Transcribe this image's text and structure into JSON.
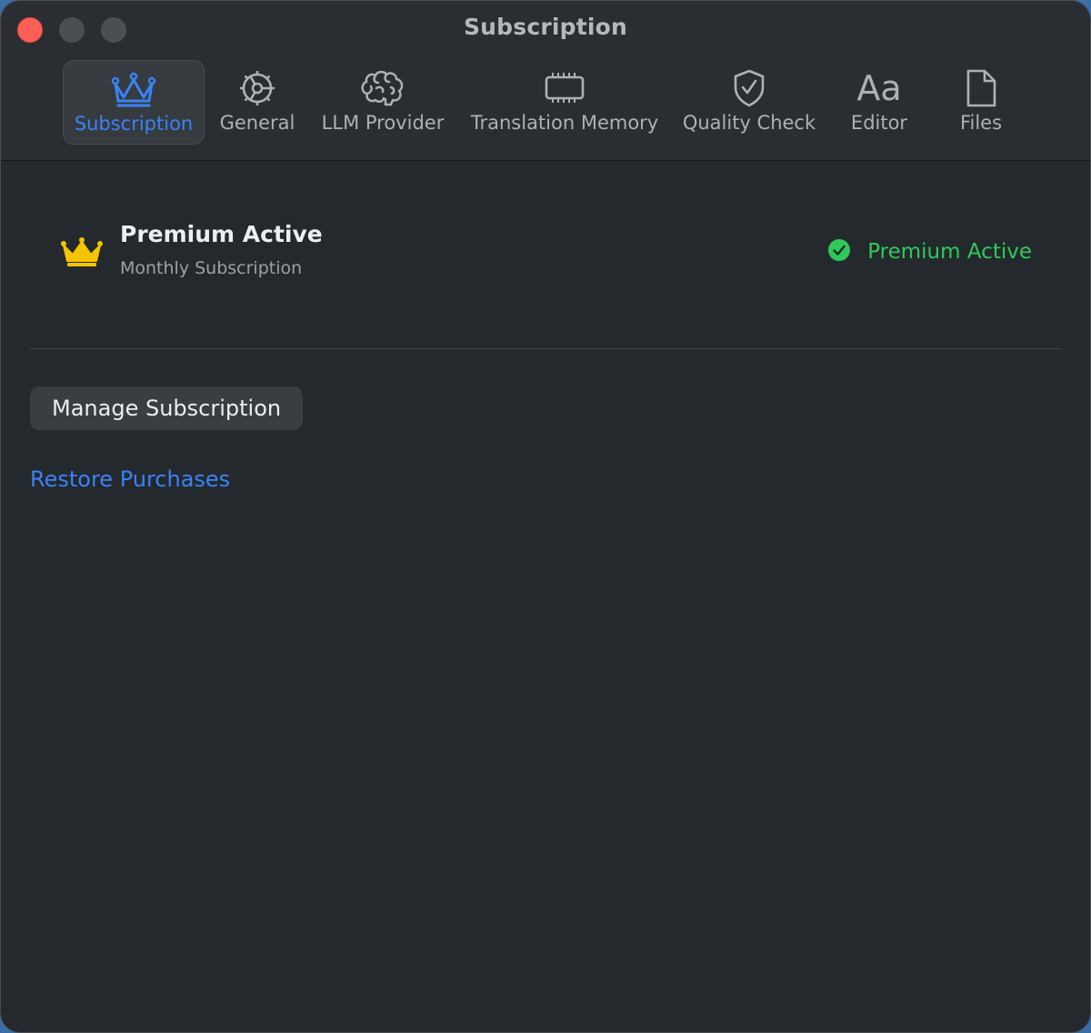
{
  "window": {
    "title": "Subscription"
  },
  "toolbar": {
    "items": [
      {
        "label": "Subscription",
        "icon": "crown-icon",
        "selected": true
      },
      {
        "label": "General",
        "icon": "gear-icon",
        "selected": false
      },
      {
        "label": "LLM Provider",
        "icon": "brain-icon",
        "selected": false
      },
      {
        "label": "Translation Memory",
        "icon": "memory-chip-icon",
        "selected": false
      },
      {
        "label": "Quality Check",
        "icon": "shield-check-icon",
        "selected": false
      },
      {
        "label": "Editor",
        "icon": "text-format-icon",
        "glyph": "Aa",
        "selected": false
      },
      {
        "label": "Files",
        "icon": "document-icon",
        "selected": false
      }
    ]
  },
  "status": {
    "title": "Premium Active",
    "subtitle": "Monthly Subscription",
    "badge_text": "Premium Active",
    "badge_icon": "checkmark-circle-icon"
  },
  "actions": {
    "manage_label": "Manage Subscription",
    "restore_label": "Restore Purchases"
  },
  "colors": {
    "accent": "#3b82f6",
    "success": "#30c85a",
    "crown": "#f5c400",
    "close": "#fe5f57"
  }
}
